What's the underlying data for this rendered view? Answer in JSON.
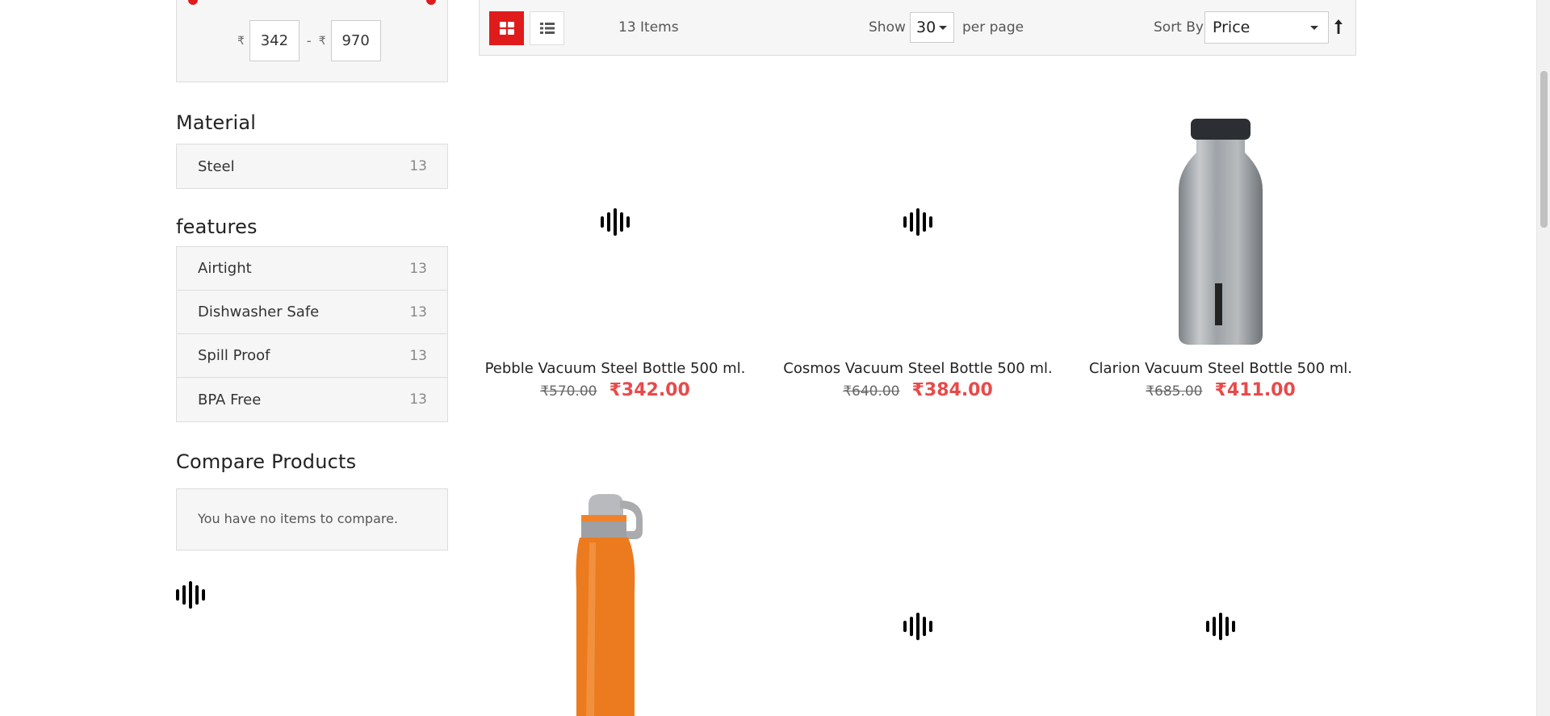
{
  "price_filter": {
    "currency": "₹",
    "min": "342",
    "separator": "-",
    "max": "970"
  },
  "material": {
    "title": "Material",
    "items": [
      {
        "label": "Steel",
        "count": "13"
      }
    ]
  },
  "features": {
    "title": "features",
    "items": [
      {
        "label": "Airtight",
        "count": "13"
      },
      {
        "label": "Dishwasher Safe",
        "count": "13"
      },
      {
        "label": "Spill Proof",
        "count": "13"
      },
      {
        "label": "BPA Free",
        "count": "13"
      }
    ]
  },
  "compare": {
    "title": "Compare Products",
    "empty_text": "You have no items to compare."
  },
  "toolbar": {
    "items_count": "13 Items",
    "show_label": "Show",
    "limit_value": "30",
    "per_page_label": "per page",
    "sort_by_label": "Sort By",
    "sort_value": "Price",
    "grid_icon": "grid-view-icon",
    "list_icon": "list-view-icon",
    "sort_direction_icon": "arrow-up-icon"
  },
  "products": [
    {
      "name": "Pebble Vacuum Steel Bottle 500 ml.",
      "old_price": "₹570.00",
      "price": "₹342.00",
      "image": "loading-icon"
    },
    {
      "name": "Cosmos Vacuum Steel Bottle 500 ml.",
      "old_price": "₹640.00",
      "price": "₹384.00",
      "image": "loading-icon"
    },
    {
      "name": "Clarion Vacuum Steel Bottle 500 ml.",
      "old_price": "₹685.00",
      "price": "₹411.00",
      "image": "steel-bottle-image"
    },
    {
      "image": "orange-bottle-image"
    },
    {
      "image": "loading-icon"
    },
    {
      "image": "loading-icon"
    }
  ],
  "colors": {
    "accent": "#e01b1b",
    "price": "#e84a4a"
  }
}
